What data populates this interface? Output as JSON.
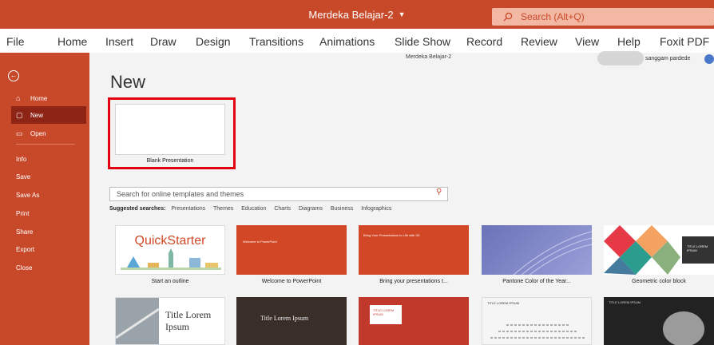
{
  "titlebar": {
    "doc_title": "Merdeka Belajar-2",
    "search_label": "Search (Alt+Q)"
  },
  "ribbon_tabs": [
    "File",
    "Home",
    "Insert",
    "Draw",
    "Design",
    "Transitions",
    "Animations",
    "Slide Show",
    "Record",
    "Review",
    "View",
    "Help",
    "Foxit PDF"
  ],
  "doc_name_small": "Merdeka Belajar-2",
  "user_name": "sanggam pardede",
  "sidebar": {
    "items": [
      "Home",
      "New",
      "Open",
      "Info",
      "Save",
      "Save As",
      "Print",
      "Share",
      "Export",
      "Close"
    ],
    "active": "New"
  },
  "page_title": "New",
  "blank": {
    "label": "Blank Presentation"
  },
  "template_search": {
    "placeholder": "Search for online templates and themes"
  },
  "suggested": {
    "label": "Suggested searches:",
    "items": [
      "Presentations",
      "Themes",
      "Education",
      "Charts",
      "Diagrams",
      "Business",
      "Infographics"
    ]
  },
  "templates": [
    {
      "label": "Start an outline",
      "thumb_text": "QuickStarter"
    },
    {
      "label": "Welcome to PowerPoint",
      "thumb_text": "Welcome to PowerPoint"
    },
    {
      "label": "Bring your presentations t...",
      "thumb_text": "Bring Your Presentations to Life with 3D"
    },
    {
      "label": "Pantone Color of the Year...",
      "thumb_text": ""
    },
    {
      "label": "Geometric color block",
      "thumb_text": "TITLE LOREM IPSUM"
    }
  ],
  "templates_row2": [
    {
      "thumb_text": "Title Lorem Ipsum"
    },
    {
      "thumb_text": "Title Lorem Ipsum"
    },
    {
      "thumb_text": "TITLE LOREM IPSUM"
    },
    {
      "thumb_text": "TITLE LOREM IPSUM"
    },
    {
      "thumb_text": "TITLE LOREM IPSUM"
    }
  ],
  "colors": {
    "accent": "#c8492a",
    "active_nav": "#8d2416",
    "highlight_box": "#e3000f"
  },
  "icons": [
    "search-icon",
    "back-arrow-icon",
    "home-icon",
    "new-document-icon",
    "open-folder-icon",
    "chevron-down-icon"
  ]
}
